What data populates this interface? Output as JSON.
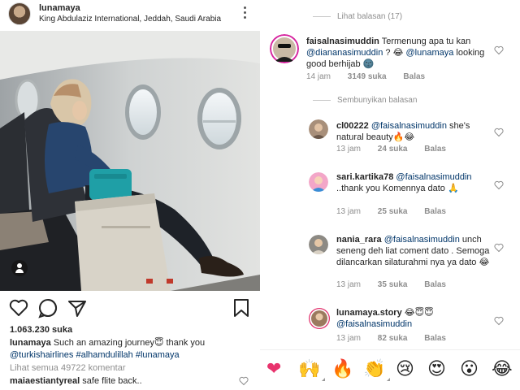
{
  "post": {
    "username": "lunamaya",
    "location": "King Abdulaziz International, Jeddah, Saudi Arabia",
    "likes": "1.063.230 suka",
    "caption_user": "lunamaya",
    "caption_text": "Such an amazing journey😇 thank you",
    "caption_tags": "@turkishairlines #alhamdulillah #lunamaya",
    "view_comments": "Lihat semua 49722 komentar",
    "first_comment_user": "maiaestiantyreal",
    "first_comment_text": "safe flite back.."
  },
  "thread": {
    "view_replies": "Lihat balasan (17)",
    "hide_replies": "Sembunyikan balasan",
    "main": {
      "user": "faisalnasimuddin",
      "text": "Termenung apa tu kan",
      "mention1": "@diananasimuddin",
      "mid": " ? 😂 ",
      "mention2": "@lunamaya",
      "tail": " looking good berhijab 🌚",
      "time": "14 jam",
      "likes": "3149 suka",
      "reply": "Balas"
    },
    "replies": [
      {
        "user": "cl00222",
        "mention": "@faisalnasimuddin",
        "text": " she's natural beauty🔥😂",
        "time": "13 jam",
        "likes": "24 suka",
        "reply": "Balas"
      },
      {
        "user": "sari.kartika78",
        "mention": "@faisalnasimuddin",
        "text": " ..thank you Komennya dato 🙏",
        "time": "13 jam",
        "likes": "25 suka",
        "reply": "Balas"
      },
      {
        "user": "nania_rara",
        "mention": "@faisalnasimuddin",
        "text": " unch seneng deh liat coment dato . Semoga dilancarkan silaturahmi nya ya dato 😂",
        "time": "13 jam",
        "likes": "35 suka",
        "reply": "Balas"
      },
      {
        "user": "lunamaya.story",
        "mention": "@faisalnasimuddin",
        "prefix": " 😂😇😇 ",
        "text": "",
        "time": "13 jam",
        "likes": "82 suka",
        "reply": "Balas"
      }
    ]
  },
  "reactions": [
    "❤",
    "🙌",
    "🔥",
    "👏",
    "😢",
    "😍",
    "😮",
    "😂"
  ]
}
